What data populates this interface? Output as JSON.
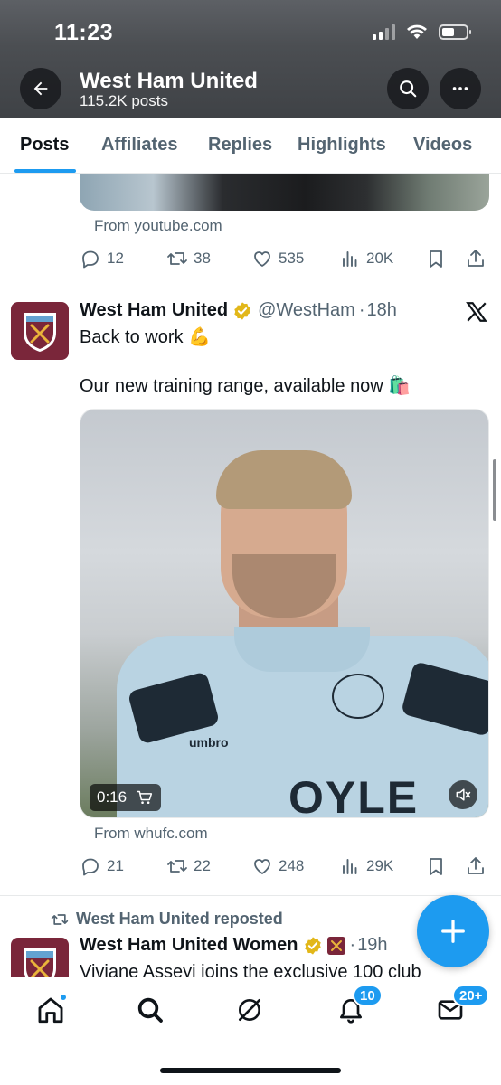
{
  "status_bar": {
    "time": "11:23"
  },
  "header": {
    "title": "West Ham United",
    "post_count": "115.2K posts"
  },
  "tabs": [
    {
      "label": "Posts",
      "active": true
    },
    {
      "label": "Affiliates"
    },
    {
      "label": "Replies"
    },
    {
      "label": "Highlights"
    },
    {
      "label": "Videos"
    }
  ],
  "previous_post": {
    "source": "From youtube.com",
    "replies": "12",
    "reposts": "38",
    "likes": "535",
    "views": "20K"
  },
  "post": {
    "name": "West Ham United",
    "handle": "@WestHam",
    "time": "18h",
    "text_line1": "Back to work 💪",
    "text_line2": "Our new training range, available now 🛍️",
    "video_time": "0:16",
    "video_brand": "umbro",
    "video_sponsor": "OYLE",
    "source": "From whufc.com",
    "replies": "21",
    "reposts": "22",
    "likes": "248",
    "views": "29K"
  },
  "repost": {
    "label": "West Ham United reposted",
    "name": "West Ham United Women",
    "time": "19h",
    "text": "Viviane Asseyi joins the exclusive 100 club"
  },
  "nav": {
    "notifications_badge": "10",
    "messages_badge": "20+"
  },
  "colors": {
    "accent": "#1d9bf0",
    "verified_gold": "#e2b719",
    "claret": "#7a263a"
  }
}
